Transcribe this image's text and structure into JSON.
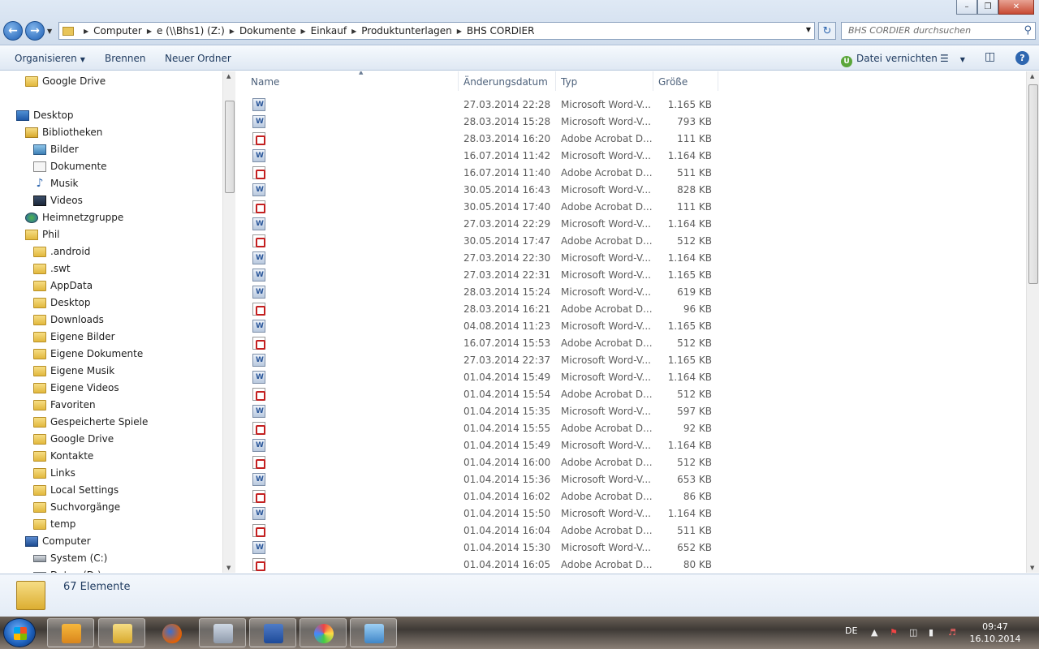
{
  "address": {
    "crumbs": [
      "Computer",
      "e (\\\\Bhs1) (Z:)",
      "Dokumente",
      "Einkauf",
      "Produktunterlagen",
      "BHS CORDIER"
    ]
  },
  "search": {
    "placeholder": "BHS CORDIER durchsuchen"
  },
  "toolbar": {
    "organize": "Organisieren",
    "burn": "Brennen",
    "new_folder": "Neuer Ordner",
    "shred": "Datei vernichten"
  },
  "columns": {
    "name": "Name",
    "date": "Änderungsdatum",
    "type": "Typ",
    "size": "Größe"
  },
  "nav": [
    {
      "label": "Google Drive",
      "icon": "folder",
      "level": 1
    },
    {
      "label": "Desktop",
      "icon": "desktop",
      "level": 0
    },
    {
      "label": "Bibliotheken",
      "icon": "library",
      "level": 1
    },
    {
      "label": "Bilder",
      "icon": "pictures",
      "level": 2
    },
    {
      "label": "Dokumente",
      "icon": "documents",
      "level": 2
    },
    {
      "label": "Musik",
      "icon": "music",
      "level": 2
    },
    {
      "label": "Videos",
      "icon": "videos",
      "level": 2
    },
    {
      "label": "Heimnetzgruppe",
      "icon": "homegroup",
      "level": 1
    },
    {
      "label": "Phil",
      "icon": "user-folder",
      "level": 1
    },
    {
      "label": ".android",
      "icon": "folder",
      "level": 2
    },
    {
      "label": ".swt",
      "icon": "folder",
      "level": 2
    },
    {
      "label": "AppData",
      "icon": "folder",
      "level": 2
    },
    {
      "label": "Desktop",
      "icon": "folder",
      "level": 2
    },
    {
      "label": "Downloads",
      "icon": "folder",
      "level": 2
    },
    {
      "label": "Eigene Bilder",
      "icon": "folder",
      "level": 2
    },
    {
      "label": "Eigene Dokumente",
      "icon": "folder",
      "level": 2
    },
    {
      "label": "Eigene Musik",
      "icon": "folder",
      "level": 2
    },
    {
      "label": "Eigene Videos",
      "icon": "folder",
      "level": 2
    },
    {
      "label": "Favoriten",
      "icon": "folder",
      "level": 2
    },
    {
      "label": "Gespeicherte Spiele",
      "icon": "folder",
      "level": 2
    },
    {
      "label": "Google Drive",
      "icon": "folder",
      "level": 2
    },
    {
      "label": "Kontakte",
      "icon": "folder",
      "level": 2
    },
    {
      "label": "Links",
      "icon": "folder",
      "level": 2
    },
    {
      "label": "Local Settings",
      "icon": "folder",
      "level": 2
    },
    {
      "label": "Suchvorgänge",
      "icon": "folder",
      "level": 2
    },
    {
      "label": "temp",
      "icon": "folder",
      "level": 2
    },
    {
      "label": "Computer",
      "icon": "computer",
      "level": 1
    },
    {
      "label": "System (C:)",
      "icon": "drive",
      "level": 2
    },
    {
      "label": "Daten (D:)",
      "icon": "drive",
      "level": 2
    }
  ],
  "files": [
    {
      "kind": "word",
      "date": "27.03.2014 22:28",
      "type": "Microsoft Word-V...",
      "size": "1.165 KB"
    },
    {
      "kind": "word",
      "date": "28.03.2014 15:28",
      "type": "Microsoft Word-V...",
      "size": "793 KB"
    },
    {
      "kind": "pdf",
      "date": "28.03.2014 16:20",
      "type": "Adobe Acrobat D...",
      "size": "111 KB"
    },
    {
      "kind": "word",
      "date": "16.07.2014 11:42",
      "type": "Microsoft Word-V...",
      "size": "1.164 KB"
    },
    {
      "kind": "pdf",
      "date": "16.07.2014 11:40",
      "type": "Adobe Acrobat D...",
      "size": "511 KB"
    },
    {
      "kind": "word",
      "date": "30.05.2014 16:43",
      "type": "Microsoft Word-V...",
      "size": "828 KB"
    },
    {
      "kind": "pdf",
      "date": "30.05.2014 17:40",
      "type": "Adobe Acrobat D...",
      "size": "111 KB"
    },
    {
      "kind": "word",
      "date": "27.03.2014 22:29",
      "type": "Microsoft Word-V...",
      "size": "1.164 KB"
    },
    {
      "kind": "pdf",
      "date": "30.05.2014 17:47",
      "type": "Adobe Acrobat D...",
      "size": "512 KB"
    },
    {
      "kind": "word",
      "date": "27.03.2014 22:30",
      "type": "Microsoft Word-V...",
      "size": "1.164 KB"
    },
    {
      "kind": "word",
      "date": "27.03.2014 22:31",
      "type": "Microsoft Word-V...",
      "size": "1.165 KB"
    },
    {
      "kind": "word",
      "date": "28.03.2014 15:24",
      "type": "Microsoft Word-V...",
      "size": "619 KB"
    },
    {
      "kind": "pdf",
      "date": "28.03.2014 16:21",
      "type": "Adobe Acrobat D...",
      "size": "96 KB"
    },
    {
      "kind": "word",
      "date": "04.08.2014 11:23",
      "type": "Microsoft Word-V...",
      "size": "1.165 KB"
    },
    {
      "kind": "pdf",
      "date": "16.07.2014 15:53",
      "type": "Adobe Acrobat D...",
      "size": "512 KB"
    },
    {
      "kind": "word",
      "date": "27.03.2014 22:37",
      "type": "Microsoft Word-V...",
      "size": "1.165 KB"
    },
    {
      "kind": "word",
      "date": "01.04.2014 15:49",
      "type": "Microsoft Word-V...",
      "size": "1.164 KB"
    },
    {
      "kind": "pdf",
      "date": "01.04.2014 15:54",
      "type": "Adobe Acrobat D...",
      "size": "512 KB"
    },
    {
      "kind": "word",
      "date": "01.04.2014 15:35",
      "type": "Microsoft Word-V...",
      "size": "597 KB"
    },
    {
      "kind": "pdf",
      "date": "01.04.2014 15:55",
      "type": "Adobe Acrobat D...",
      "size": "92 KB"
    },
    {
      "kind": "word",
      "date": "01.04.2014 15:49",
      "type": "Microsoft Word-V...",
      "size": "1.164 KB"
    },
    {
      "kind": "pdf",
      "date": "01.04.2014 16:00",
      "type": "Adobe Acrobat D...",
      "size": "512 KB"
    },
    {
      "kind": "word",
      "date": "01.04.2014 15:36",
      "type": "Microsoft Word-V...",
      "size": "653 KB"
    },
    {
      "kind": "pdf",
      "date": "01.04.2014 16:02",
      "type": "Adobe Acrobat D...",
      "size": "86 KB"
    },
    {
      "kind": "word",
      "date": "01.04.2014 15:50",
      "type": "Microsoft Word-V...",
      "size": "1.164 KB"
    },
    {
      "kind": "pdf",
      "date": "01.04.2014 16:04",
      "type": "Adobe Acrobat D...",
      "size": "511 KB"
    },
    {
      "kind": "word",
      "date": "01.04.2014 15:30",
      "type": "Microsoft Word-V...",
      "size": "652 KB"
    },
    {
      "kind": "pdf",
      "date": "01.04.2014 16:05",
      "type": "Adobe Acrobat D...",
      "size": "80 KB"
    }
  ],
  "status": {
    "count": "67 Elemente"
  },
  "taskbar": {
    "apps": [
      "outlook-icon",
      "explorer-icon",
      "firefox-icon",
      "calculator-icon",
      "word-icon",
      "paint-icon",
      "control-panel-icon"
    ],
    "lang": "DE",
    "time": "09:47",
    "date": "16.10.2014"
  }
}
